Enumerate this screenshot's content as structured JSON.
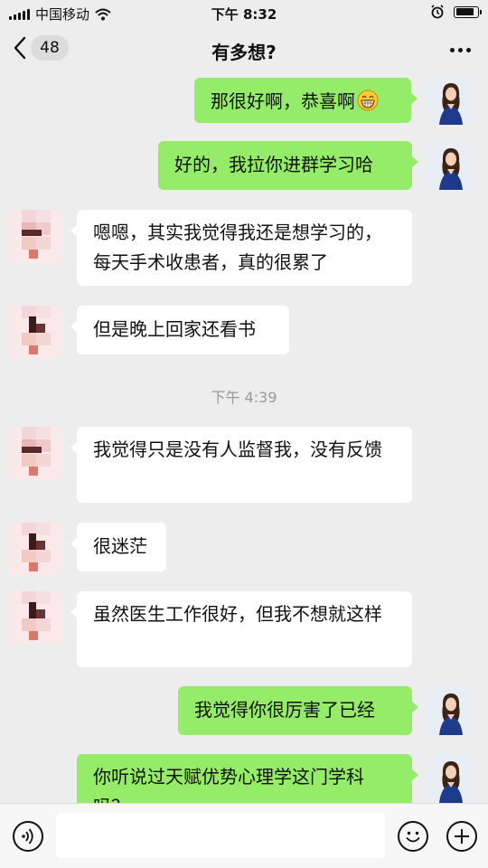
{
  "status_bar": {
    "carrier": "中国移动",
    "time": "下午 8:32",
    "battery_level": 0.9
  },
  "nav": {
    "unread_count": "48",
    "title": "有多想?"
  },
  "messages": [
    {
      "side": "me",
      "text": "那很好啊，恭喜啊"
    },
    {
      "side": "me",
      "text": "好的，我拉你进群学习哈"
    },
    {
      "side": "other",
      "text": "嗯嗯，其实我觉得我还是想学习的，每天手术收患者，真的很累了"
    },
    {
      "side": "other",
      "text": "但是晚上回家还看书"
    },
    {
      "side": "other",
      "text": "我觉得只是没有人监督我，没有反馈"
    },
    {
      "side": "other",
      "text": "很迷茫"
    },
    {
      "side": "other",
      "text": "虽然医生工作很好，但我不想就这样"
    },
    {
      "side": "me",
      "text": "我觉得你很厉害了已经"
    },
    {
      "side": "me",
      "text": "你听说过天赋优势心理学这门学科吗？"
    }
  ],
  "timestamp": "下午 4:39",
  "input": {
    "placeholder": ""
  },
  "colors": {
    "my_bubble": "#95ec69",
    "other_bubble": "#ffffff",
    "background": "#ededed"
  }
}
